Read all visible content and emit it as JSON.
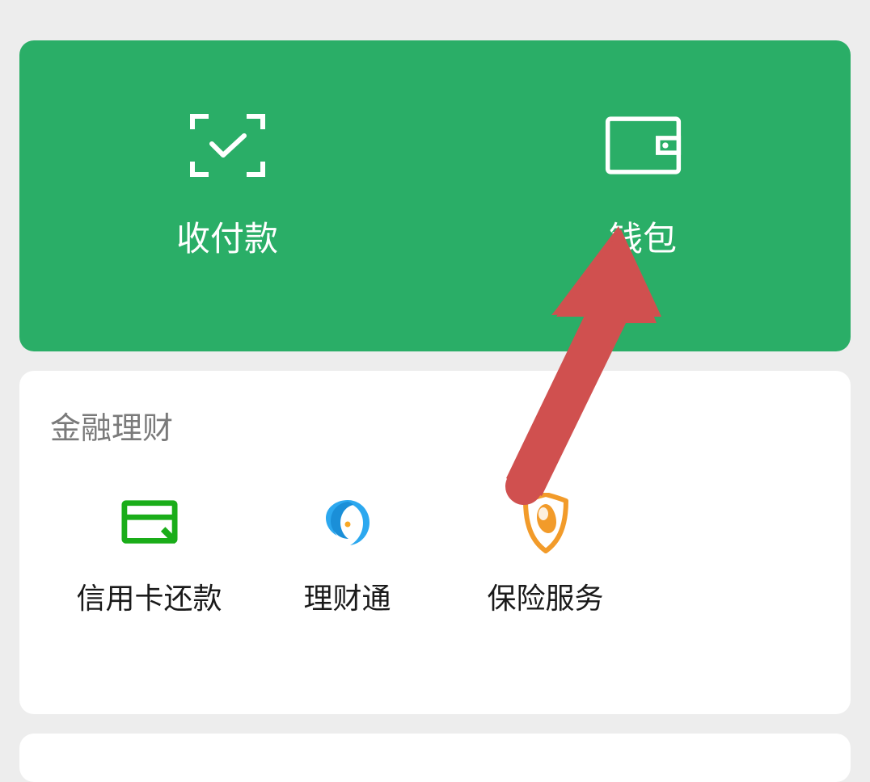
{
  "topCard": {
    "items": [
      {
        "label": "收付款",
        "icon": "scan-pay-icon"
      },
      {
        "label": "钱包",
        "icon": "wallet-icon"
      }
    ]
  },
  "financeSection": {
    "title": "金融理财",
    "services": [
      {
        "label": "信用卡还款",
        "icon": "credit-card-icon"
      },
      {
        "label": "理财通",
        "icon": "licaitong-icon"
      },
      {
        "label": "保险服务",
        "icon": "insurance-icon"
      }
    ]
  },
  "colors": {
    "primaryGreen": "#2aae67",
    "iconGreen": "#1aad19",
    "iconBlue": "#2ca8ef",
    "iconOrange": "#f29b2a",
    "arrowRed": "#d0504f"
  }
}
